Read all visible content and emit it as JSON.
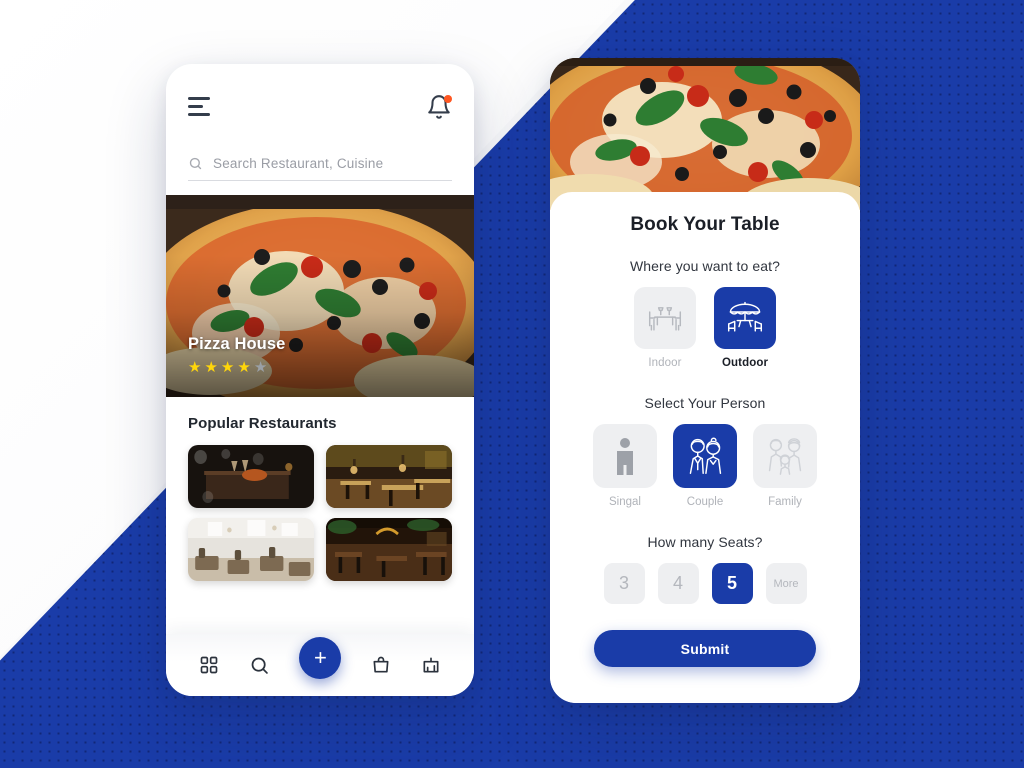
{
  "background": {
    "accent_blue": "#1a3ca8",
    "light": "#f4f5f7"
  },
  "left_phone": {
    "header": {
      "menu_icon": "hamburger-icon",
      "notification_icon": "bell-icon",
      "notification_badge_color": "#ff5722"
    },
    "search": {
      "icon": "search-icon",
      "placeholder": "Search Restaurant, Cuisine",
      "value": ""
    },
    "hero": {
      "image": "pizza-photo",
      "title": "Pizza House",
      "rating_filled": 4,
      "rating_total": 5,
      "star_on_color": "#ffd60a",
      "star_off_color": "#9aa0a6"
    },
    "popular": {
      "heading": "Popular Restaurants",
      "items": [
        {
          "name": "restaurant-thumbnail-1"
        },
        {
          "name": "restaurant-thumbnail-2"
        },
        {
          "name": "restaurant-thumbnail-3"
        },
        {
          "name": "restaurant-thumbnail-4"
        }
      ]
    },
    "bottom_nav": {
      "items": [
        {
          "icon": "grid-icon",
          "name": "nav-dashboard"
        },
        {
          "icon": "search-icon",
          "name": "nav-search"
        },
        {
          "icon": "plus-icon",
          "name": "nav-add",
          "label": "+",
          "primary": true
        },
        {
          "icon": "bag-icon",
          "name": "nav-orders"
        },
        {
          "icon": "stats-icon",
          "name": "nav-stats"
        }
      ]
    }
  },
  "right_phone": {
    "hero": {
      "image": "pizza-photo"
    },
    "title": "Book Your Table",
    "location": {
      "question": "Where you want to eat?",
      "options": [
        {
          "label": "Indoor",
          "icon": "indoor-table-icon",
          "selected": false
        },
        {
          "label": "Outdoor",
          "icon": "outdoor-umbrella-icon",
          "selected": true
        }
      ]
    },
    "person": {
      "question": "Select Your Person",
      "options": [
        {
          "label": "Singal",
          "icon": "single-person-icon",
          "selected": false
        },
        {
          "label": "Couple",
          "icon": "couple-icon",
          "selected": true
        },
        {
          "label": "Family",
          "icon": "family-icon",
          "selected": false
        }
      ]
    },
    "seats": {
      "question": "How many Seats?",
      "options": [
        {
          "label": "3",
          "selected": false
        },
        {
          "label": "4",
          "selected": false
        },
        {
          "label": "5",
          "selected": true
        },
        {
          "label": "More",
          "selected": false
        }
      ]
    },
    "submit_label": "Submit"
  }
}
